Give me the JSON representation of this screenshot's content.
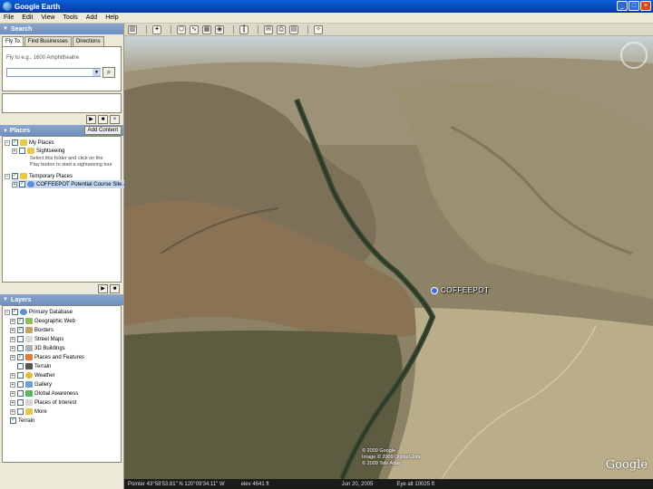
{
  "window": {
    "title": "Google Earth"
  },
  "menu": [
    "File",
    "Edit",
    "View",
    "Tools",
    "Add",
    "Help"
  ],
  "search": {
    "header": "Search",
    "tabs": [
      "Fly To",
      "Find Businesses",
      "Directions"
    ],
    "hint": "Fly to e.g., 1600 Amphitheatre"
  },
  "places": {
    "header": "Places",
    "add_content": "Add Content",
    "items": [
      {
        "label": "My Places"
      },
      {
        "label": "Sightseeing"
      },
      {
        "label": "Temporary Places"
      },
      {
        "label": "COFFEEPOT Potential Course Site and Status"
      }
    ],
    "desc_lines": [
      "Select this folder and click on the",
      "Play button to start a sightseeing tour"
    ]
  },
  "layers": {
    "header": "Layers",
    "items": [
      {
        "label": "Primary Database"
      },
      {
        "label": "Geographic Web"
      },
      {
        "label": "Borders"
      },
      {
        "label": "Street Maps"
      },
      {
        "label": "3D Buildings"
      },
      {
        "label": "Places and Features"
      },
      {
        "label": "Terrain"
      },
      {
        "label": "Weather"
      },
      {
        "label": "Gallery"
      },
      {
        "label": "Global Awareness"
      },
      {
        "label": "Places of Interest"
      },
      {
        "label": "More"
      },
      {
        "label": "Terrain"
      }
    ]
  },
  "map": {
    "placemark": "COFFEEPOT",
    "copyright": [
      "© 2009 Google",
      "Image © 2009 DigitalGlobe",
      "© 2009 Tele Atlas"
    ],
    "logo": "Google"
  },
  "status": {
    "pointer": "Pointer 43°58'53.81\" N 120°09'34.11\" W",
    "elev": "elev 4641 ft",
    "date": "Jun 20, 2005",
    "eye": "Eye alt 10025 ft"
  }
}
